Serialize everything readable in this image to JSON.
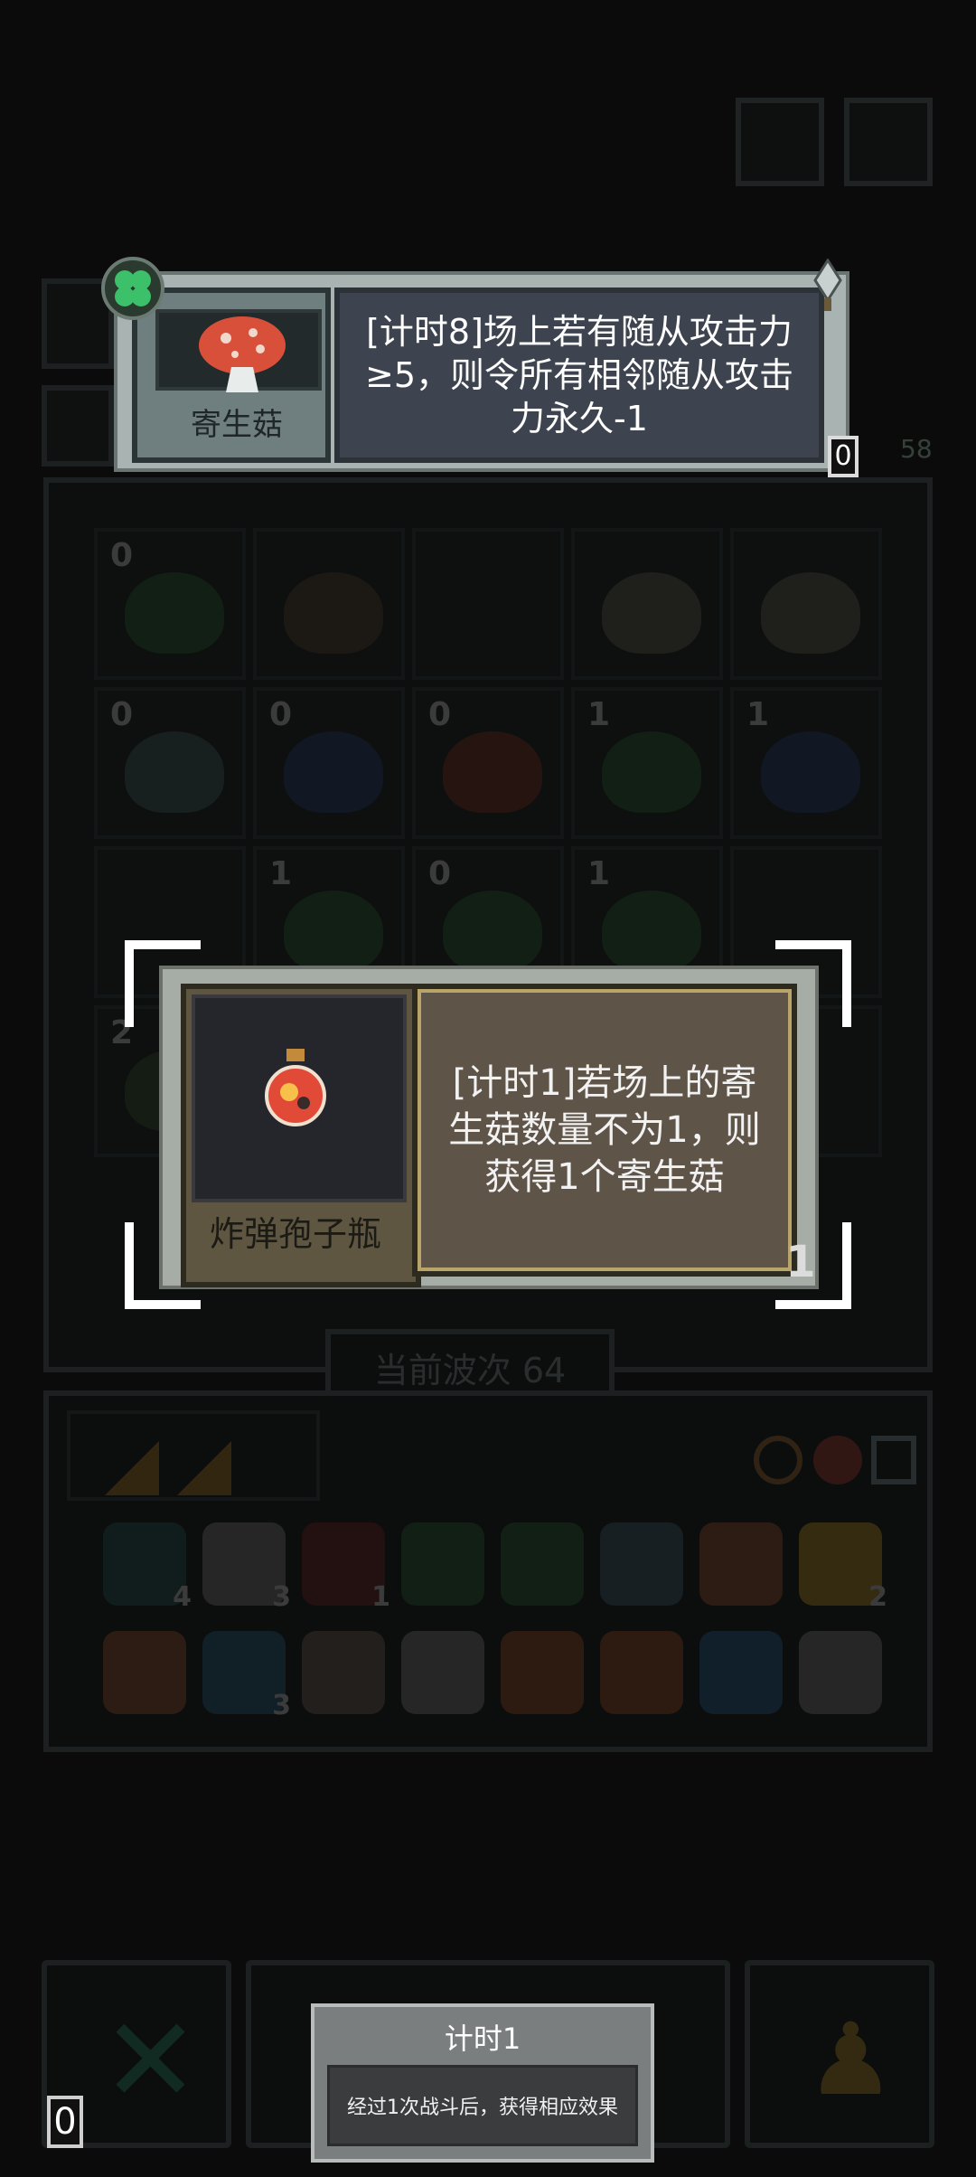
{
  "top_tooltip": {
    "unit_name": "寄生菇",
    "description": "[计时8]场上若有随从攻击力≥5，则令所有相邻随从攻击力永久-1",
    "corner_count": "0"
  },
  "item_tooltip": {
    "item_name": "炸弹孢子瓶",
    "description": "[计时1]若场上的寄生菇数量不为1，则获得1个寄生菇",
    "count": "1"
  },
  "board": {
    "wave_label": "当前波次 64",
    "right_counter": "58",
    "cells": [
      {
        "num": "0"
      },
      {
        "num": ""
      },
      {
        "num": ""
      },
      {
        "num": ""
      },
      {
        "num": ""
      },
      {
        "num": "0"
      },
      {
        "num": "0"
      },
      {
        "num": "0"
      },
      {
        "num": "1"
      },
      {
        "num": "1"
      },
      {
        "num": ""
      },
      {
        "num": "1"
      },
      {
        "num": "0"
      },
      {
        "num": "1"
      },
      {
        "num": ""
      },
      {
        "num": "2"
      },
      {
        "num": ""
      },
      {
        "num": ""
      },
      {
        "num": ""
      },
      {
        "num": ""
      }
    ]
  },
  "inventory": {
    "row1_counts": [
      "4",
      "3",
      "1",
      "",
      "",
      "",
      "",
      "2"
    ],
    "row2_counts": [
      "",
      "3",
      "",
      "",
      "",
      "",
      "",
      ""
    ]
  },
  "timer_tooltip": {
    "title": "计时1",
    "body": "经过1次战斗后，获得相应效果"
  },
  "bottom_left_count": "0",
  "colors": {
    "mushroom_cap": "#d8503a",
    "clover": "#3cc06a",
    "bomb": "#e24a38",
    "accent_gold": "#b9a46a"
  }
}
